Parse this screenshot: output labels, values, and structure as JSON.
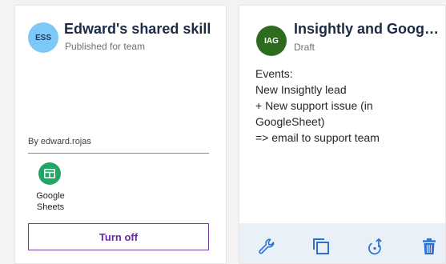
{
  "cards": [
    {
      "avatar_initials": "ESS",
      "title": "Edward's shared skill",
      "status": "Published for team",
      "author": "By edward.rojas",
      "app": {
        "name": "Google Sheets",
        "icon": "google-sheets-icon"
      },
      "action_label": "Turn off"
    },
    {
      "avatar_initials": "IAG",
      "title": "Insightly and Google...",
      "status": "Draft",
      "description_lines": [
        "Events:",
        "New Insightly lead",
        "+ New support issue (in",
        "GoogleSheet)",
        "=> email to support team"
      ],
      "toolbar": [
        "wrench-icon",
        "duplicate-icon",
        "share-icon",
        "trash-icon"
      ]
    }
  ],
  "colors": {
    "accent_purple": "#7b3fa6",
    "sheets_green": "#23a566",
    "tool_blue": "#2c6fd1",
    "avatar_blue": "#7ec8f8",
    "avatar_green": "#2e6b1e"
  }
}
